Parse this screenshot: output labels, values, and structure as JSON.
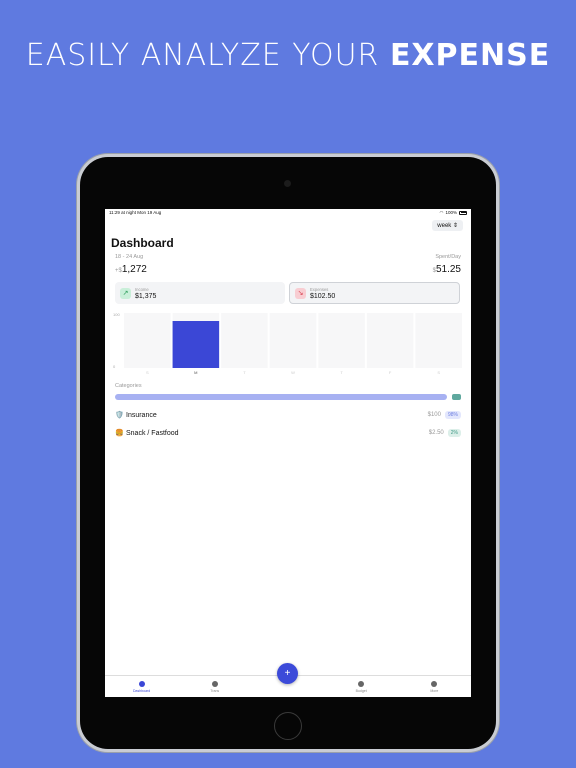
{
  "headline": {
    "prefix": "EASILY ANALYZE YOUR",
    "emphasis": "EXPENSE"
  },
  "status": {
    "time": "11:29 at night",
    "date": "Mon 19 Aug",
    "battery": "100%"
  },
  "period_selector": {
    "value": "week"
  },
  "title": "Dashboard",
  "summary": {
    "range": "18 - 24 Aug",
    "total_prefix": "+$",
    "total": "1,272",
    "spent_label": "Spent/Day",
    "spent_prefix": "$",
    "spent": "51.25"
  },
  "cards": {
    "income": {
      "label": "Income",
      "amount": "$1,375"
    },
    "expenses": {
      "label": "Expenses",
      "amount": "$102.50"
    }
  },
  "chart_data": {
    "type": "bar",
    "categories": [
      "S",
      "M",
      "T",
      "W",
      "T",
      "F",
      "S"
    ],
    "values": [
      0,
      100,
      0,
      0,
      0,
      0,
      0
    ],
    "yticks": [
      "100",
      "0"
    ],
    "ylim": [
      0,
      100
    ],
    "highlight_index": 1,
    "colors": {
      "bar": "#3b47d6",
      "background": "#f7f7f8"
    }
  },
  "categories_section": {
    "label": "Categories",
    "items": [
      {
        "emoji": "🛡️",
        "name": "Insurance",
        "amount": "$100",
        "percent": "98%"
      },
      {
        "emoji": "🍔",
        "name": "Snack / Fastfood",
        "amount": "$2.50",
        "percent": "2%"
      }
    ]
  },
  "tabs": [
    {
      "label": "Dashboard",
      "icon": "pie-chart-icon",
      "active": true
    },
    {
      "label": "Trans",
      "icon": "search-icon",
      "active": false
    },
    {
      "label": "",
      "icon": "",
      "active": false
    },
    {
      "label": "Budget",
      "icon": "wallet-icon",
      "active": false
    },
    {
      "label": "More",
      "icon": "more-icon",
      "active": false
    }
  ],
  "add_button": {
    "symbol": "+"
  },
  "colors": {
    "background": "#5f7ae0",
    "accent": "#3b47d6"
  }
}
